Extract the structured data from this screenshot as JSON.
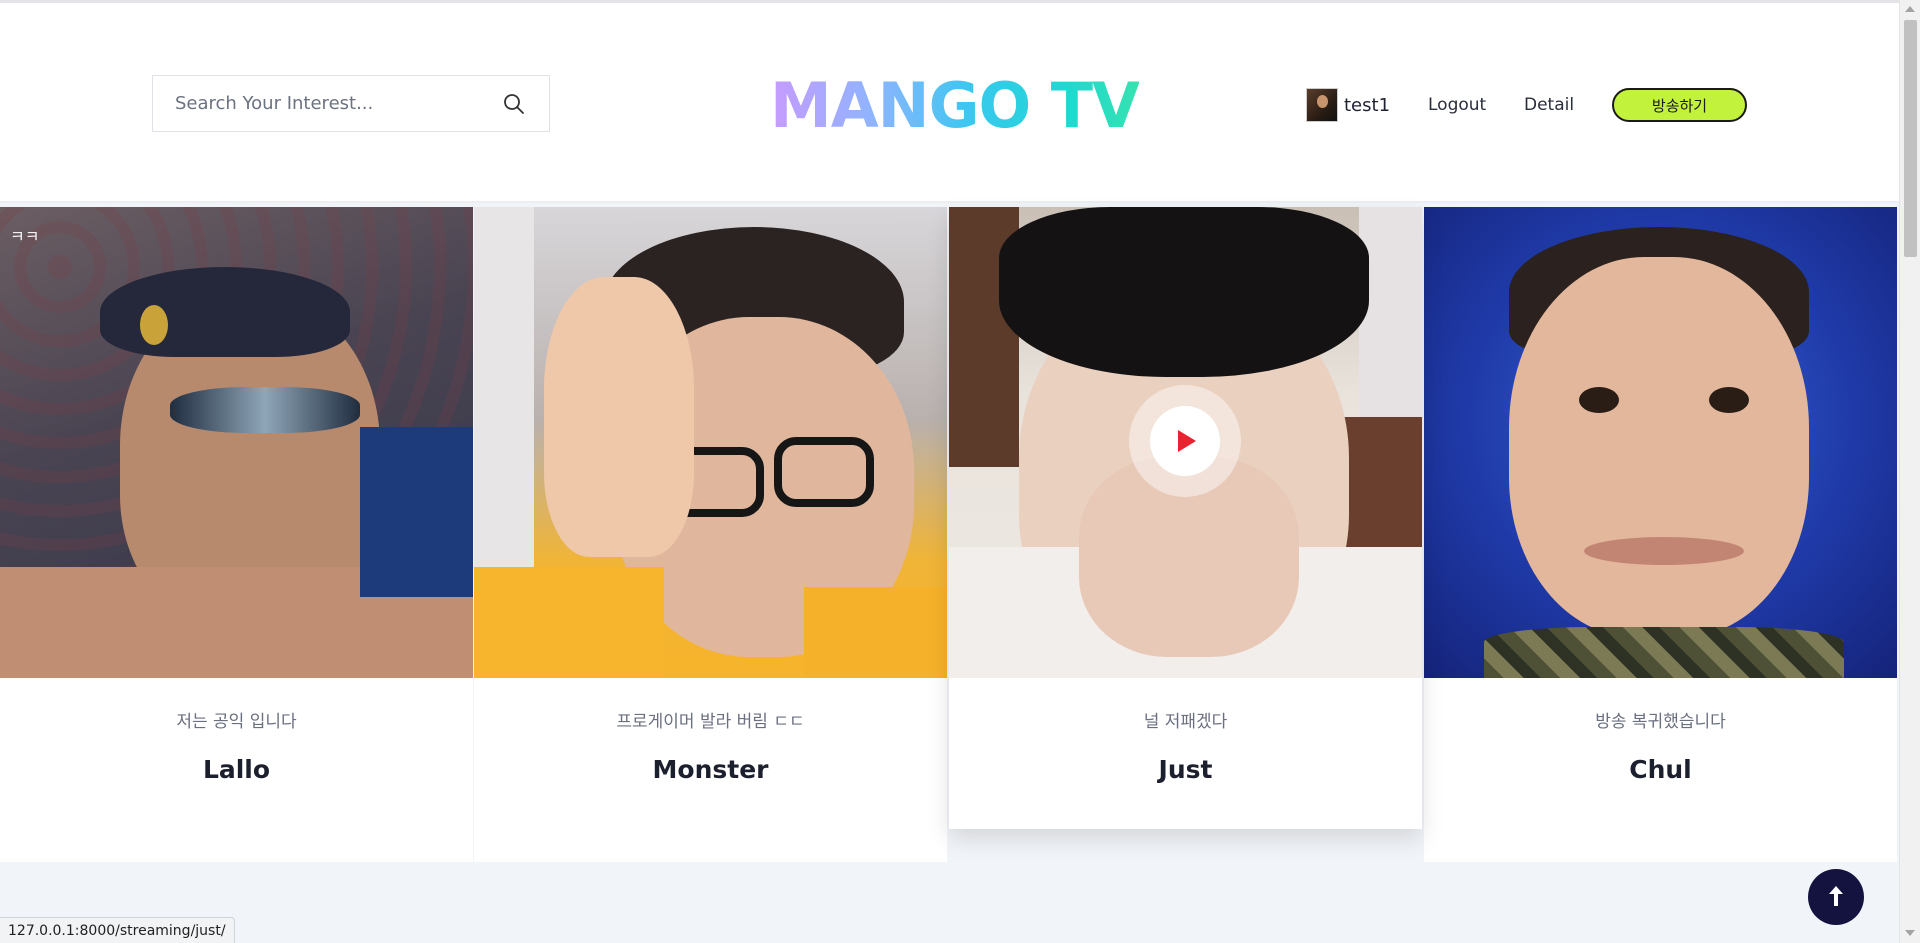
{
  "header": {
    "search": {
      "placeholder": "Search Your Interest...",
      "icon": "search-icon"
    },
    "logo_text": "MANGO TV",
    "logo_gradient": [
      "#c79bff",
      "#8fb4ff",
      "#38c8ef",
      "#1fd8d1",
      "#35e2b0"
    ],
    "user": {
      "name": "test1"
    },
    "nav": {
      "logout": "Logout",
      "detail": "Detail"
    },
    "broadcast_button": {
      "label": "방송하기",
      "color": "#c2f23b"
    }
  },
  "streams": [
    {
      "description": "저는 공익 입니다",
      "name": "Lallo",
      "overlay_text": "ㅋㅋ"
    },
    {
      "description": "프로게이머 발라 버림 ㄷㄷ",
      "name": "Monster"
    },
    {
      "description": "널 저패겠다",
      "name": "Just",
      "hovered": true,
      "play_icon": "play-icon"
    },
    {
      "description": "방송 복귀했습니다",
      "name": "Chul"
    }
  ],
  "status_bar": {
    "url": "127.0.0.1:8000/streaming/just/"
  },
  "scroll_top_button": {
    "icon": "arrow-up-icon",
    "color": "#14133f"
  }
}
